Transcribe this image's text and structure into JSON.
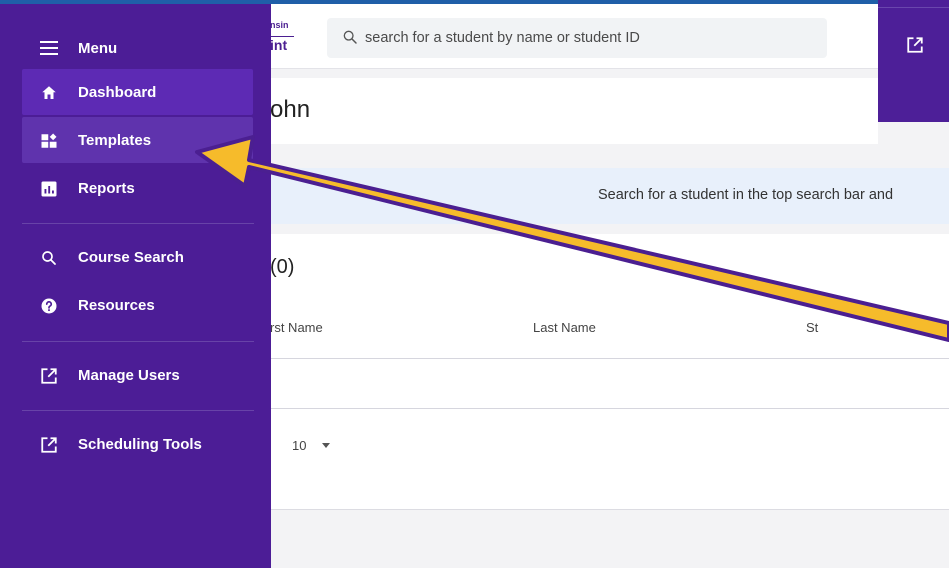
{
  "header": {
    "logo_top": "nsin",
    "logo_bottom": "int",
    "search_placeholder": "search for a student by name or student ID"
  },
  "sidebar": {
    "menu_label": "Menu",
    "items": [
      {
        "label": "Dashboard",
        "icon": "home-icon"
      },
      {
        "label": "Templates",
        "icon": "dashboard-icon"
      },
      {
        "label": "Reports",
        "icon": "bar-chart-icon"
      },
      {
        "label": "Course Search",
        "icon": "search-icon"
      },
      {
        "label": "Resources",
        "icon": "help-icon"
      },
      {
        "label": "Manage Users",
        "icon": "open-in-new-icon"
      },
      {
        "label": "Scheduling Tools",
        "icon": "open-in-new-icon"
      }
    ]
  },
  "main": {
    "title": "ohn",
    "info_text": "Search for a student in the top search bar and",
    "count_title": "(0)",
    "columns": [
      "rst Name",
      "Last Name",
      "St"
    ],
    "rows_per_page": "10"
  },
  "colors": {
    "sidebar": "#4c1d96",
    "accent": "#5d2ab4",
    "arrow_fill": "#f6bb2b",
    "arrow_stroke": "#4b1f91"
  }
}
